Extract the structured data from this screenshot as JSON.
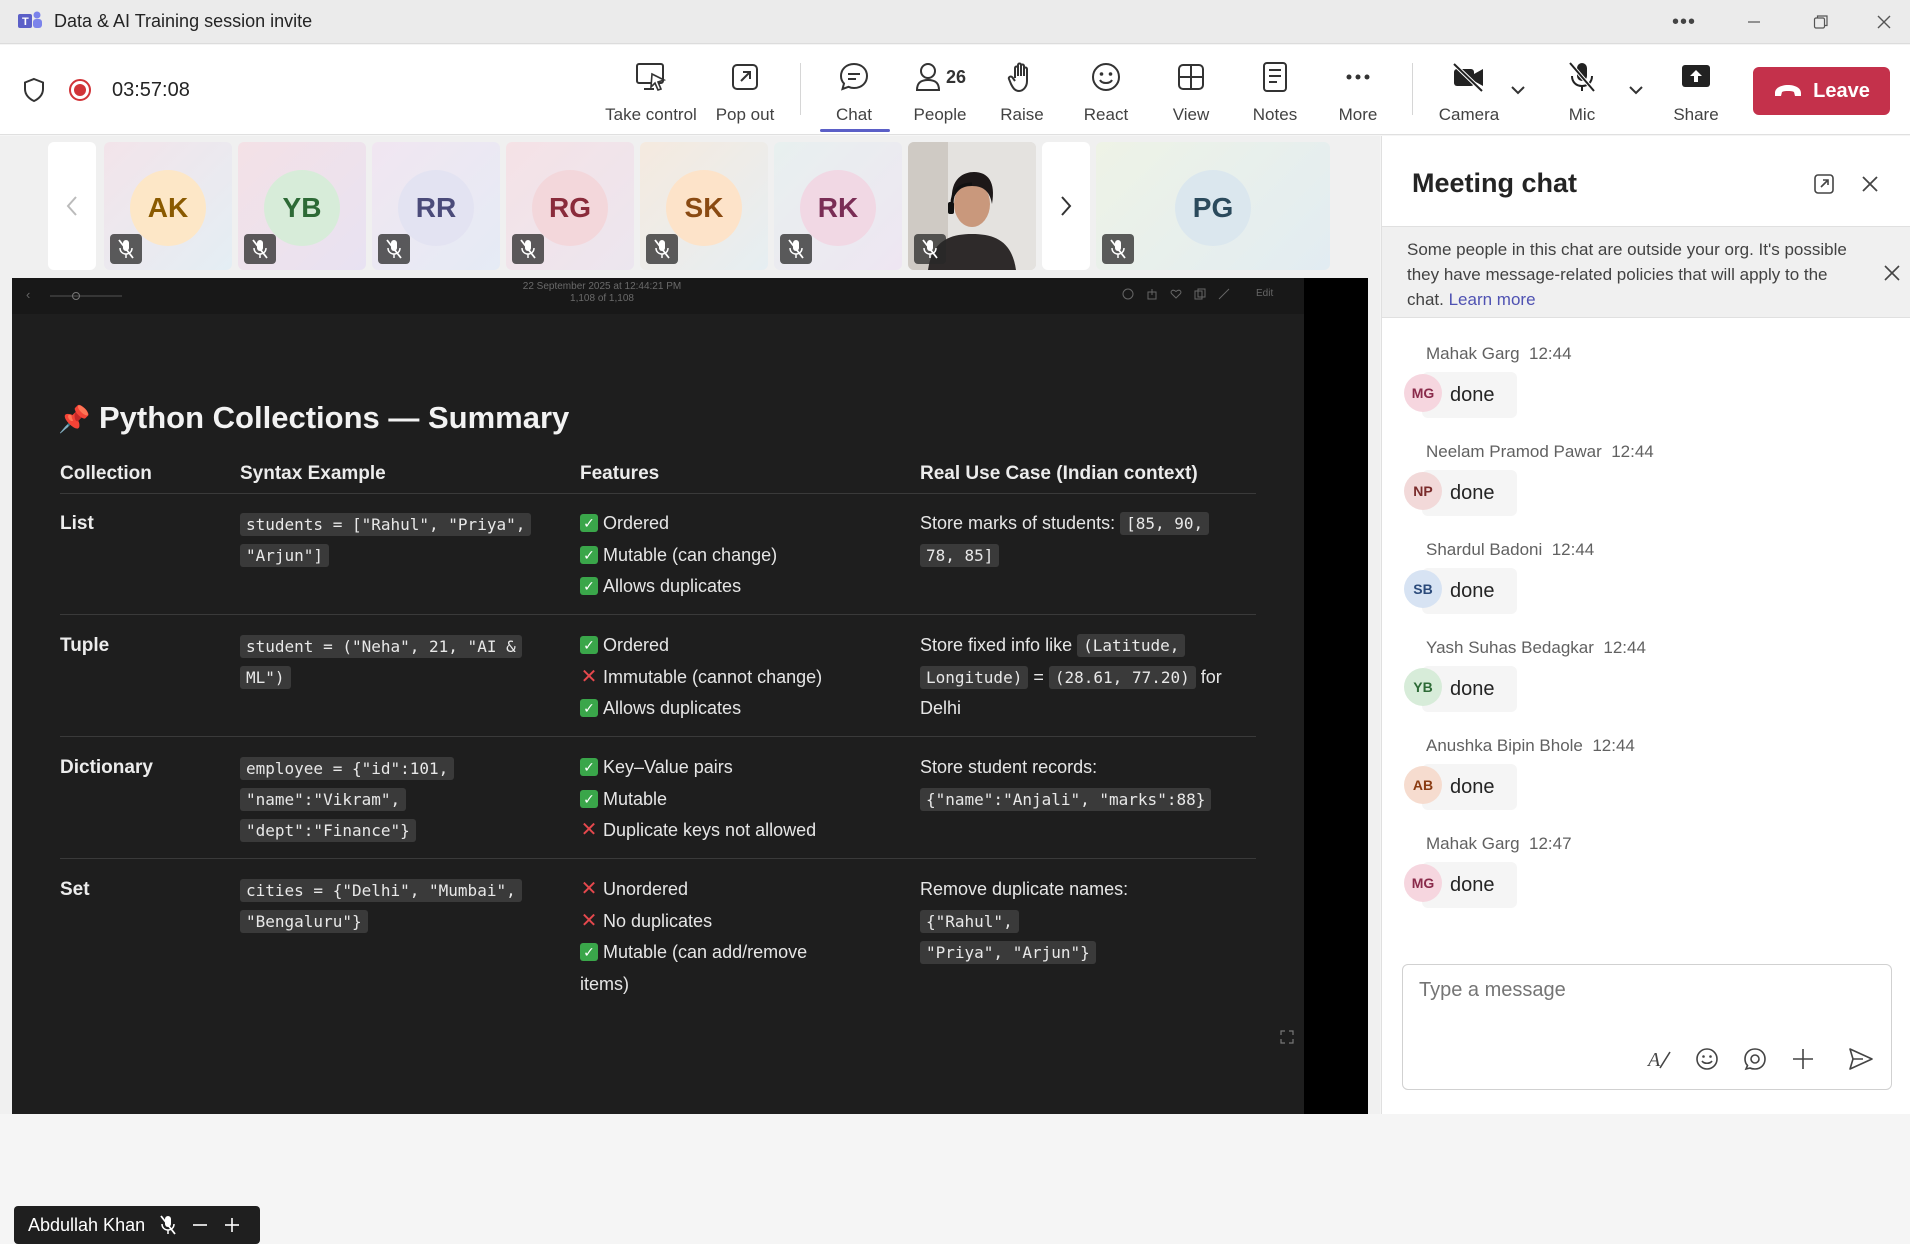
{
  "window": {
    "title": "Data & AI Training session invite",
    "more_icon": "more-horizontal-icon"
  },
  "toolbar": {
    "timer": "03:57:08",
    "take_control": "Take control",
    "pop_out": "Pop out",
    "chat": "Chat",
    "people": "People",
    "people_count": "26",
    "raise": "Raise",
    "react": "React",
    "view": "View",
    "notes": "Notes",
    "more": "More",
    "camera": "Camera",
    "mic": "Mic",
    "share": "Share",
    "leave": "Leave",
    "colors": {
      "leave": "#c4314b",
      "accent": "#5b5fc7",
      "record": "#d13438"
    }
  },
  "participants": [
    {
      "initials": "AK",
      "bg": "#fde7c7",
      "fg": "#8a5a00"
    },
    {
      "initials": "YB",
      "bg": "#d7ecd9",
      "fg": "#2d6a36"
    },
    {
      "initials": "RR",
      "bg": "#e3e3f2",
      "fg": "#4b4b7a"
    },
    {
      "initials": "RG",
      "bg": "#f3d7db",
      "fg": "#8a2b3b"
    },
    {
      "initials": "SK",
      "bg": "#fde3c9",
      "fg": "#8a4a12"
    },
    {
      "initials": "RK",
      "bg": "#f1d8e4",
      "fg": "#7a2d55"
    },
    {
      "initials": "PG",
      "bg": "#dbe7ee",
      "fg": "#2b4a5c"
    }
  ],
  "slide_topbar": {
    "date": "22 September 2025 at 12:44:21 PM",
    "page": "1,108 of 1,108",
    "edit": "Edit"
  },
  "slide": {
    "pin": "📌",
    "title": "Python Collections — Summary",
    "headers": [
      "Collection",
      "Syntax Example",
      "Features",
      "Real Use Case (Indian context)"
    ],
    "rows": [
      {
        "name": "List",
        "syntax": [
          "students = [\"Rahul\", \"Priya\",",
          "\"Arjun\"]"
        ],
        "features": [
          {
            "mark": "check",
            "text": "Ordered"
          },
          {
            "mark": "check",
            "text": "Mutable (can change)"
          },
          {
            "mark": "check",
            "text": "Allows duplicates"
          }
        ],
        "usecase_text": "Store marks of students:",
        "usecase_code": [
          "[85, 90,",
          "78, 85]"
        ]
      },
      {
        "name": "Tuple",
        "syntax": [
          "student = (\"Neha\", 21, \"AI &",
          "ML\")"
        ],
        "features": [
          {
            "mark": "check",
            "text": "Ordered"
          },
          {
            "mark": "cross",
            "text": "Immutable (cannot change)"
          },
          {
            "mark": "check",
            "text": "Allows duplicates"
          }
        ],
        "usecase_text": "Store fixed info like",
        "usecase_code1": "(Latitude,",
        "usecase_code2": "Longitude)",
        "usecase_eq": "=",
        "usecase_code3": "(28.61, 77.20)",
        "usecase_for": "for",
        "usecase_city": "Delhi"
      },
      {
        "name": "Dictionary",
        "syntax": [
          "employee = {\"id\":101,",
          "\"name\":\"Vikram\",",
          "\"dept\":\"Finance\"}"
        ],
        "features": [
          {
            "mark": "check",
            "text": "Key–Value pairs"
          },
          {
            "mark": "check",
            "text": "Mutable"
          },
          {
            "mark": "cross",
            "text": "Duplicate keys not allowed"
          }
        ],
        "usecase_text": "Store student records:",
        "usecase_code": [
          "{\"name\":\"Anjali\", \"marks\":88}"
        ]
      },
      {
        "name": "Set",
        "syntax": [
          "cities = {\"Delhi\", \"Mumbai\",",
          "\"Bengaluru\"}"
        ],
        "features": [
          {
            "mark": "cross",
            "text": "Unordered"
          },
          {
            "mark": "cross",
            "text": "No duplicates"
          },
          {
            "mark": "check",
            "text": "Mutable (can add/remove"
          },
          {
            "mark": "none",
            "text": "items)"
          }
        ],
        "usecase_text": "Remove duplicate names:",
        "usecase_code": [
          "{\"Rahul\",",
          "\"Priya\", \"Arjun\"}"
        ]
      }
    ]
  },
  "presenter": {
    "name": "Abdullah Khan"
  },
  "chat": {
    "title": "Meeting chat",
    "notice": "Some people in this chat are outside your org. It's possible they have message-related policies that will apply to the chat.",
    "notice_link": "Learn more",
    "messages": [
      {
        "name": "Mahak Garg",
        "time": "12:44",
        "initials": "MG",
        "text": "done",
        "bg": "#f6d6df",
        "fg": "#8a2b4b"
      },
      {
        "name": "Neelam Pramod Pawar",
        "time": "12:44",
        "initials": "NP",
        "text": "done",
        "bg": "#f2d9d9",
        "fg": "#7a2b2b"
      },
      {
        "name": "Shardul Badoni",
        "time": "12:44",
        "initials": "SB",
        "text": "done",
        "bg": "#d7e3f3",
        "fg": "#2b4a7a"
      },
      {
        "name": "Yash Suhas Bedagkar",
        "time": "12:44",
        "initials": "YB",
        "text": "done",
        "bg": "#d7ecd9",
        "fg": "#2d6a36"
      },
      {
        "name": "Anushka Bipin Bhole",
        "time": "12:44",
        "initials": "AB",
        "text": "done",
        "bg": "#f6dccf",
        "fg": "#8a3b12"
      },
      {
        "name": "Mahak Garg",
        "time": "12:47",
        "initials": "MG",
        "text": "done",
        "bg": "#f6d6df",
        "fg": "#8a2b4b"
      }
    ],
    "compose_placeholder": "Type a message"
  }
}
